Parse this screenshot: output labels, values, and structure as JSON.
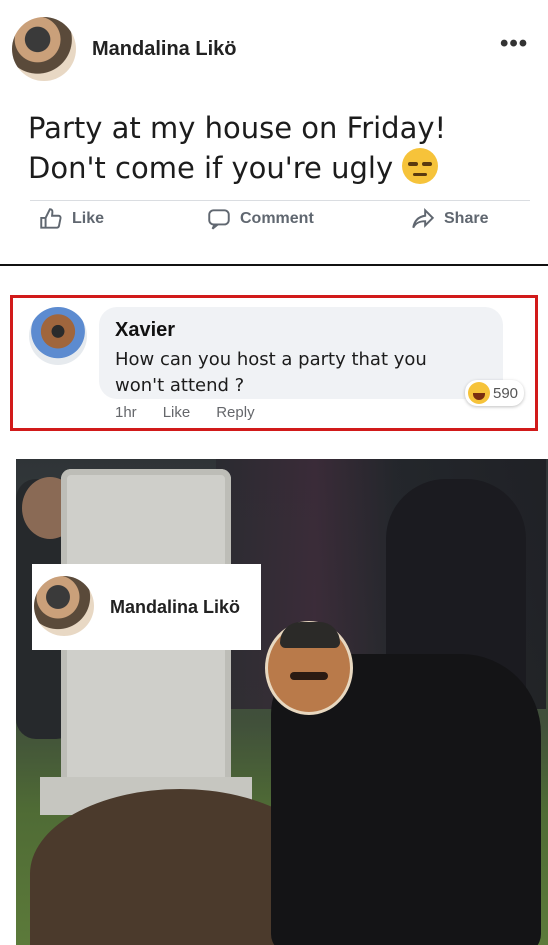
{
  "post": {
    "author": "Mandalina Likö",
    "more_label": "•••",
    "body_line1": "Party at my house on Friday!",
    "body_line2": "Don't come if you're ugly",
    "actions": {
      "like": "Like",
      "comment": "Comment",
      "share": "Share"
    }
  },
  "comment": {
    "author": "Xavier",
    "text": "How can you host a party that you won't attend ?",
    "reaction_count": "590",
    "time": "1hr",
    "like": "Like",
    "reply": "Reply"
  },
  "meme": {
    "tag_name": "Mandalina Likö"
  },
  "colors": {
    "highlight_border": "#d11a1a",
    "bubble": "#f0f2f5"
  }
}
